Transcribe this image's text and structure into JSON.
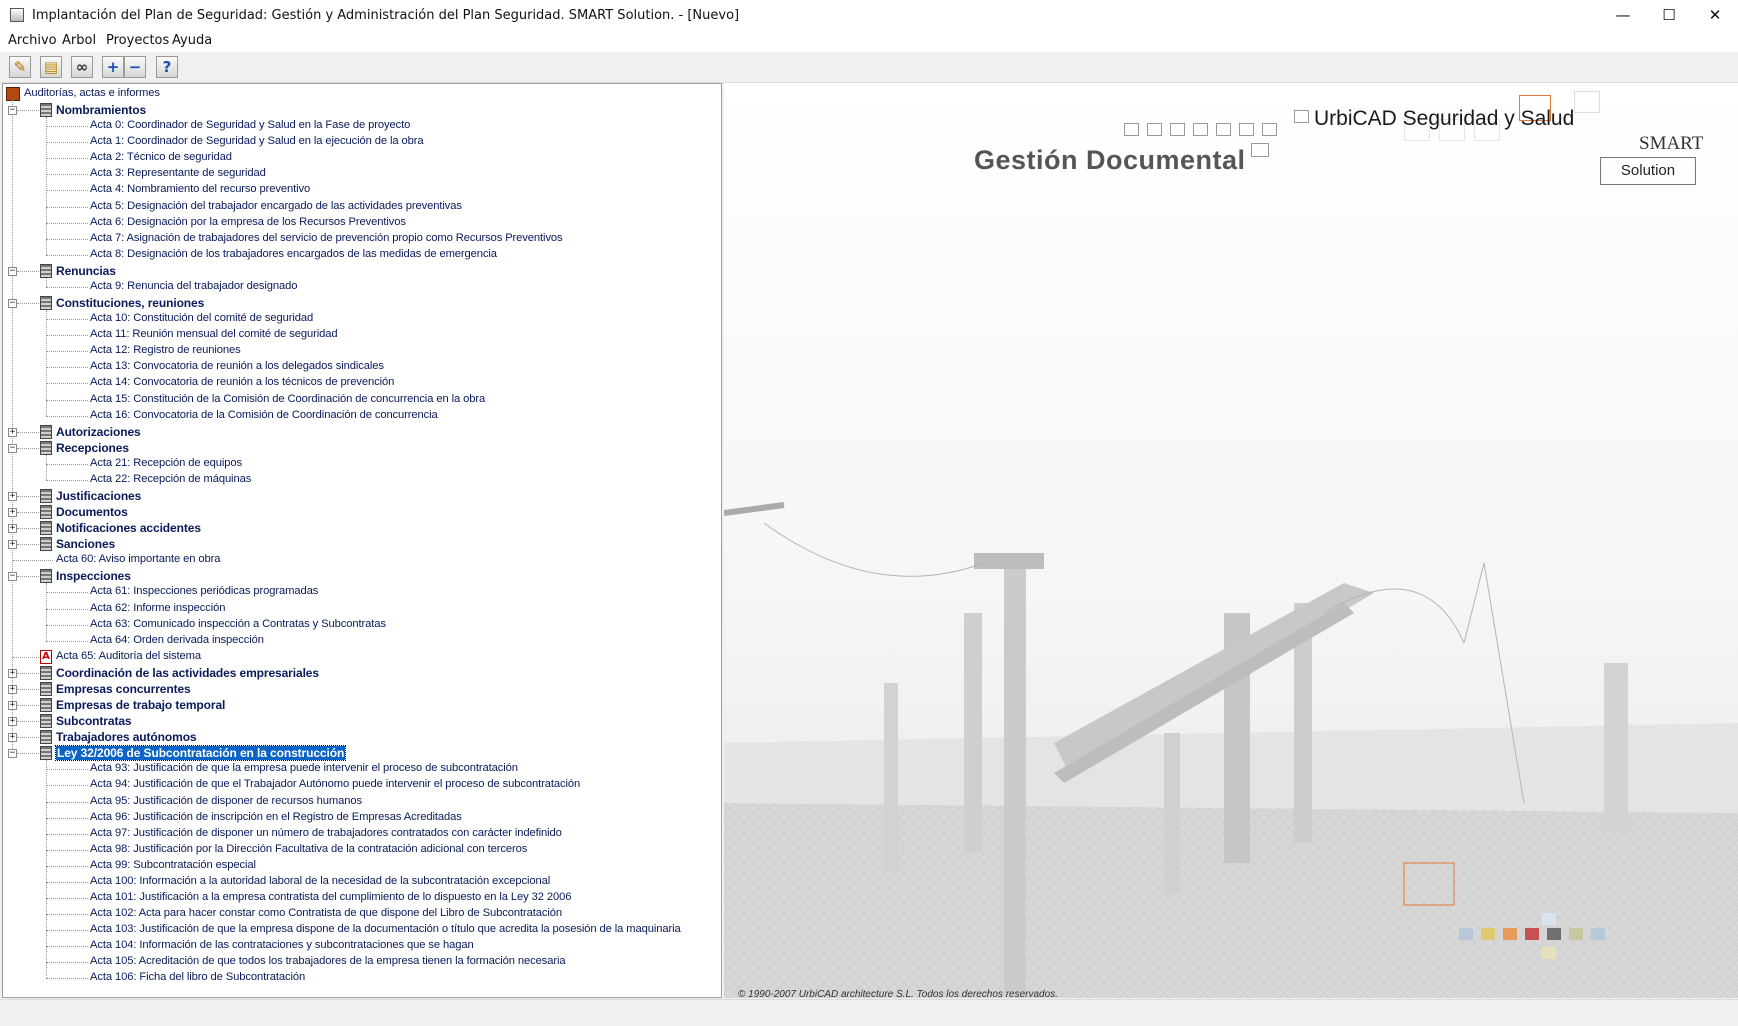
{
  "window": {
    "title": "Implantación del Plan de Seguridad: Gestión y Administración del Plan Seguridad. SMART Solution. - [Nuevo]",
    "minimize": "—",
    "maximize": "☐",
    "close": "✕"
  },
  "menu": [
    "Archivo",
    "Arbol",
    "Proyectos",
    "Ayuda"
  ],
  "toolbar_icons": [
    "edit-note-icon",
    "open-folder-icon",
    "binoculars-icon",
    "expand-plus-icon",
    "collapse-minus-icon",
    "help-icon"
  ],
  "tree": {
    "root": "Auditorías, actas e informes",
    "items": [
      {
        "type": "group",
        "expanded": true,
        "label": "Nombramientos"
      },
      {
        "type": "leaf",
        "label": "Acta 0: Coordinador de Seguridad y Salud en la Fase de proyecto"
      },
      {
        "type": "leaf",
        "label": "Acta 1: Coordinador de Seguridad y Salud en la ejecución de la obra"
      },
      {
        "type": "leaf",
        "label": "Acta 2: Técnico de seguridad"
      },
      {
        "type": "leaf",
        "label": "Acta 3: Representante de seguridad"
      },
      {
        "type": "leaf",
        "label": "Acta 4: Nombramiento del recurso preventivo"
      },
      {
        "type": "leaf",
        "label": "Acta 5: Designación del trabajador encargado de las actividades preventivas"
      },
      {
        "type": "leaf",
        "label": "Acta 6: Designación por la empresa de los Recursos Preventivos"
      },
      {
        "type": "leaf",
        "label": "Acta 7: Asignación de trabajadores del servicio de prevención propio como Recursos Preventivos"
      },
      {
        "type": "leaf",
        "label": "Acta 8: Designación de los trabajadores encargados de las medidas de emergencia"
      },
      {
        "type": "group",
        "expanded": true,
        "label": "Renuncias"
      },
      {
        "type": "leaf",
        "label": "Acta 9: Renuncia del trabajador designado"
      },
      {
        "type": "group",
        "expanded": true,
        "label": "Constituciones, reuniones"
      },
      {
        "type": "leaf",
        "label": "Acta 10: Constitución del comité de seguridad"
      },
      {
        "type": "leaf",
        "label": "Acta 11: Reunión mensual del comité de seguridad"
      },
      {
        "type": "leaf",
        "label": "Acta 12: Registro de reuniones"
      },
      {
        "type": "leaf",
        "label": "Acta 13: Convocatoria de reunión a los delegados sindicales"
      },
      {
        "type": "leaf",
        "label": "Acta 14: Convocatoria de reunión a los técnicos de prevención"
      },
      {
        "type": "leaf",
        "label": "Acta 15: Constitución de la Comisión de Coordinación de concurrencia en la obra"
      },
      {
        "type": "leaf",
        "label": "Acta 16: Convocatoria de la Comisión de Coordinación de concurrencia"
      },
      {
        "type": "group",
        "expanded": false,
        "label": "Autorizaciones"
      },
      {
        "type": "group",
        "expanded": true,
        "label": "Recepciones"
      },
      {
        "type": "leaf",
        "label": "Acta 21: Recepción de equipos"
      },
      {
        "type": "leaf",
        "label": "Acta 22: Recepción de máquinas"
      },
      {
        "type": "group",
        "expanded": false,
        "label": "Justificaciones"
      },
      {
        "type": "group",
        "expanded": false,
        "label": "Documentos"
      },
      {
        "type": "group",
        "expanded": false,
        "label": "Notificaciones accidentes"
      },
      {
        "type": "group",
        "expanded": false,
        "label": "Sanciones"
      },
      {
        "type": "rootleaf",
        "label": "Acta 60: Aviso importante en obra"
      },
      {
        "type": "group",
        "expanded": true,
        "label": "Inspecciones"
      },
      {
        "type": "leaf",
        "label": "Acta 61: Inspecciones periódicas programadas"
      },
      {
        "type": "leaf",
        "label": "Acta 62: Informe inspección"
      },
      {
        "type": "leaf",
        "label": "Acta 63: Comunicado inspección a Contratas y Subcontratas"
      },
      {
        "type": "leaf",
        "label": "Acta 64: Orden derivada inspección"
      },
      {
        "type": "pdf",
        "label": "Acta 65: Auditoría del sistema"
      },
      {
        "type": "group",
        "expanded": false,
        "label": "Coordinación de las actividades empresariales"
      },
      {
        "type": "group",
        "expanded": false,
        "label": "Empresas concurrentes"
      },
      {
        "type": "group",
        "expanded": false,
        "label": "Empresas de trabajo temporal"
      },
      {
        "type": "group",
        "expanded": false,
        "label": "Subcontratas"
      },
      {
        "type": "group",
        "expanded": false,
        "label": "Trabajadores autónomos"
      },
      {
        "type": "group",
        "expanded": true,
        "selected": true,
        "label": "Ley 32/2006 de Subcontratación en la construcción"
      },
      {
        "type": "leaf",
        "label": "Acta 93: Justificación de que la empresa puede intervenir el proceso de subcontratación"
      },
      {
        "type": "leaf",
        "label": "Acta 94: Justificación de que el Trabajador Autónomo puede intervenir el proceso de subcontratación"
      },
      {
        "type": "leaf",
        "label": "Acta 95: Justificación de disponer de recursos humanos"
      },
      {
        "type": "leaf",
        "label": "Acta 96: Justificación de inscripción en el Registro de Empresas Acreditadas"
      },
      {
        "type": "leaf",
        "label": "Acta 97: Justificación de disponer un número de trabajadores contratados con carácter indefinido"
      },
      {
        "type": "leaf",
        "label": "Acta 98: Justificación por la Dirección Facultativa de la contratación adicional con terceros"
      },
      {
        "type": "leaf",
        "label": "Acta 99: Subcontratación especial"
      },
      {
        "type": "leaf",
        "label": "Acta 100: Información a la autoridad laboral de la necesidad de la subcontratación excepcional"
      },
      {
        "type": "leaf",
        "label": "Acta 101: Justificación a la empresa contratista del cumplimiento de lo dispuesto en la Ley 32 2006"
      },
      {
        "type": "leaf",
        "label": "Acta 102: Acta para hacer constar como Contratista de que dispone del Libro de Subcontratación"
      },
      {
        "type": "leaf",
        "label": "Acta 103: Justificación de que la empresa dispone de la documentación o título que acredita la posesión de la maquinaria"
      },
      {
        "type": "leaf",
        "label": "Acta 104: Información de las contrataciones y subcontrataciones que se hagan"
      },
      {
        "type": "leaf",
        "label": "Acta 105: Acreditación de que todos los trabajadores de la empresa tienen la formación necesaria"
      },
      {
        "type": "leaf",
        "label": "Acta 106: Ficha del libro de Subcontratación"
      }
    ]
  },
  "splash": {
    "product": "UrbiCAD Seguridad y Salud",
    "module": "Gestión Documental",
    "smart": "SMART",
    "solution": "Solution",
    "copyright": "© 1990-2007 UrbiCAD architecture S.L. Todos los derechos reservados.",
    "accent": "#e07a3a"
  }
}
